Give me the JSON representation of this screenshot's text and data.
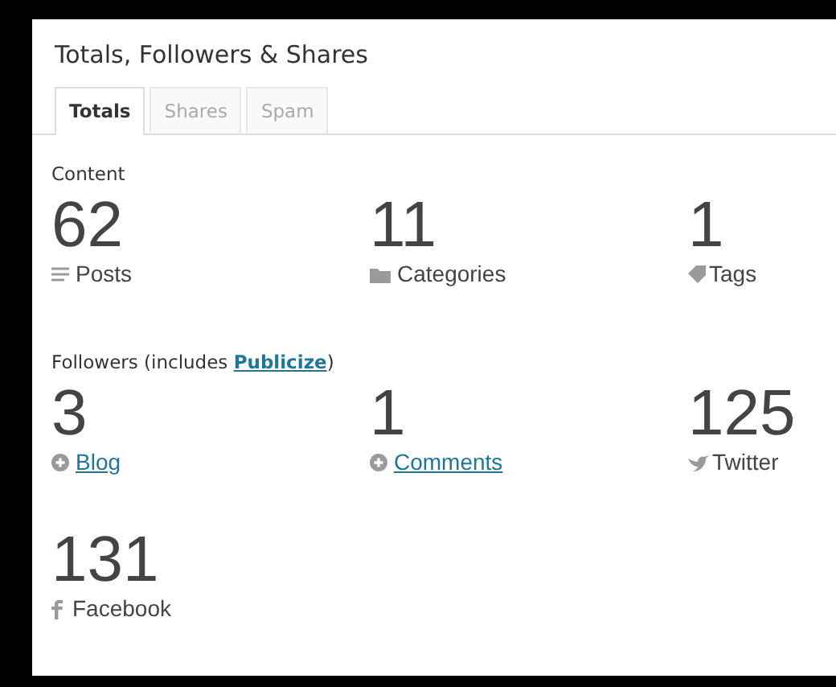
{
  "title": "Totals, Followers & Shares",
  "tabs": [
    {
      "label": "Totals",
      "selected": true
    },
    {
      "label": "Shares",
      "selected": false
    },
    {
      "label": "Spam",
      "selected": false
    }
  ],
  "sections": [
    {
      "heading": {
        "before": "Content"
      },
      "stats": [
        {
          "value": "62",
          "label": "Posts",
          "kind": "posts",
          "linked": false
        },
        {
          "value": "11",
          "label": "Categories",
          "kind": "categories",
          "linked": false
        },
        {
          "value": "1",
          "label": "Tags",
          "kind": "tags",
          "linked": false
        }
      ]
    },
    {
      "heading": {
        "before": "Followers (includes ",
        "link": "Publicize",
        "after": ")"
      },
      "stats": [
        {
          "value": "3",
          "label": "Blog",
          "kind": "blog",
          "linked": true
        },
        {
          "value": "1",
          "label": "Comments",
          "kind": "comments",
          "linked": true
        },
        {
          "value": "125",
          "label": "Twitter",
          "kind": "twitter",
          "linked": false
        },
        {
          "value": "131",
          "label": "Facebook",
          "kind": "facebook",
          "linked": false
        }
      ]
    }
  ]
}
